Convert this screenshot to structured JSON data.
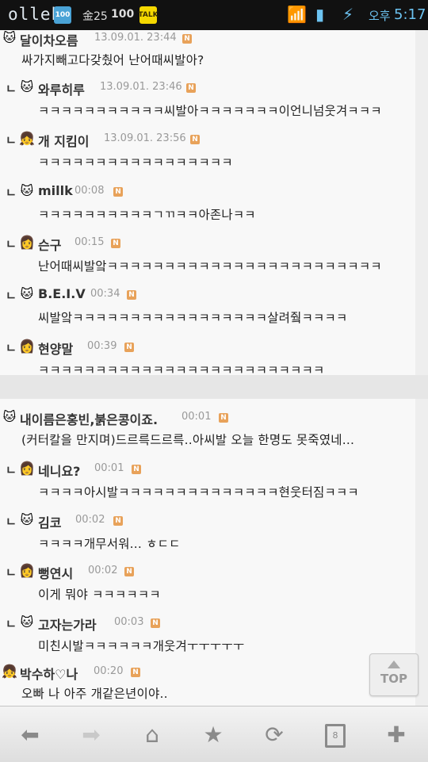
{
  "status_bar": {
    "carrier": "olleh",
    "badge_100": "100",
    "gold": "金25",
    "count": "100",
    "talk": "TALK",
    "ampm": "오후",
    "time": "5:17"
  },
  "comments": [
    {
      "name": "달이차오름",
      "time": "13.09.01. 23:44",
      "text": "싸가지빼고다갖췄어 난어때씨발아?",
      "reply": false
    },
    {
      "name": "와루히루",
      "time": "13.09.01. 23:46",
      "text": "ㅋㅋㅋㅋㅋㅋㅋㅋㅋㅋㅋ씨발아ㅋㅋㅋㅋㅋㅋㅋ이언니넘웃겨ㅋㅋㅋ",
      "reply": true
    },
    {
      "name": "개 지킴이",
      "time": "13.09.01. 23:56",
      "text": "ㅋㅋㅋㅋㅋㅋㅋㅋㅋㅋㅋㅋㅋㅋㅋㅋㅋ",
      "reply": true
    },
    {
      "name": "millk",
      "time": "00:08",
      "text": "ㅋㅋㅋㅋㅋㅋㅋㅋㅋㅋㄱㄲㅋㅋ아존나ㅋㅋ",
      "reply": true
    },
    {
      "name": "슨구",
      "time": "00:15",
      "text": "난어때씨발앜ㅋㅋㅋㅋㅋㅋㅋㅋㅋㅋㅋㅋㅋㅋㅋㅋㅋㅋㅋㅋㅋㅋㅋㅋ",
      "reply": true
    },
    {
      "name": "B.E.I.V",
      "time": "00:34",
      "text": "씨발앜ㅋㅋㅋㅋㅋㅋㅋㅋㅋㅋㅋㅋㅋㅋㅋㅋㅋ살려줰ㅋㅋㅋㅋ",
      "reply": true
    },
    {
      "name": "현양말",
      "time": "00:39",
      "text": "ㅋㅋㅋㅋㅋㅋㅋㅋㅋㅋㅋㅋㅋㅋㅋㅋㅋㅋㅋㅋㅋㅋㅋㅋㅋ",
      "reply": true
    },
    {
      "name": "내이름은홍빈,붉은콩이죠.",
      "time": "00:01",
      "text": "(커터칼을 만지며)드르륵드르륵..아씨발 오늘 한명도 못죽였네...",
      "reply": false
    },
    {
      "name": "네니요?",
      "time": "00:01",
      "text": "ㅋㅋㅋㅋ아시발ㅋㅋㅋㅋㅋㅋㅋㅋㅋㅋㅋㅋㅋㅋ현웃터짐ㅋㅋㅋ",
      "reply": true
    },
    {
      "name": "김코",
      "time": "00:02",
      "text": "ㅋㅋㅋㅋ개무서워... ㅎㄷㄷ",
      "reply": true
    },
    {
      "name": "뻥연시",
      "time": "00:02",
      "text": "이게 뭐야 ㅋㅋㅋㅋㅋㅋ",
      "reply": true
    },
    {
      "name": "고자는가라",
      "time": "00:03",
      "text": "미친시발ㅋㅋㅋㅋㅋㅋ개웃겨ㅜㅜㅜㅜㅜ",
      "reply": true
    },
    {
      "name": "박수하♡나",
      "time": "00:20",
      "text": "오빠 나 아주 개같은년이야..",
      "reply": false
    }
  ],
  "reply_mark": "ㄴ",
  "new_badge": "N",
  "top_button": {
    "label": "TOP"
  },
  "toolbar": {
    "tabs_count": "8"
  }
}
